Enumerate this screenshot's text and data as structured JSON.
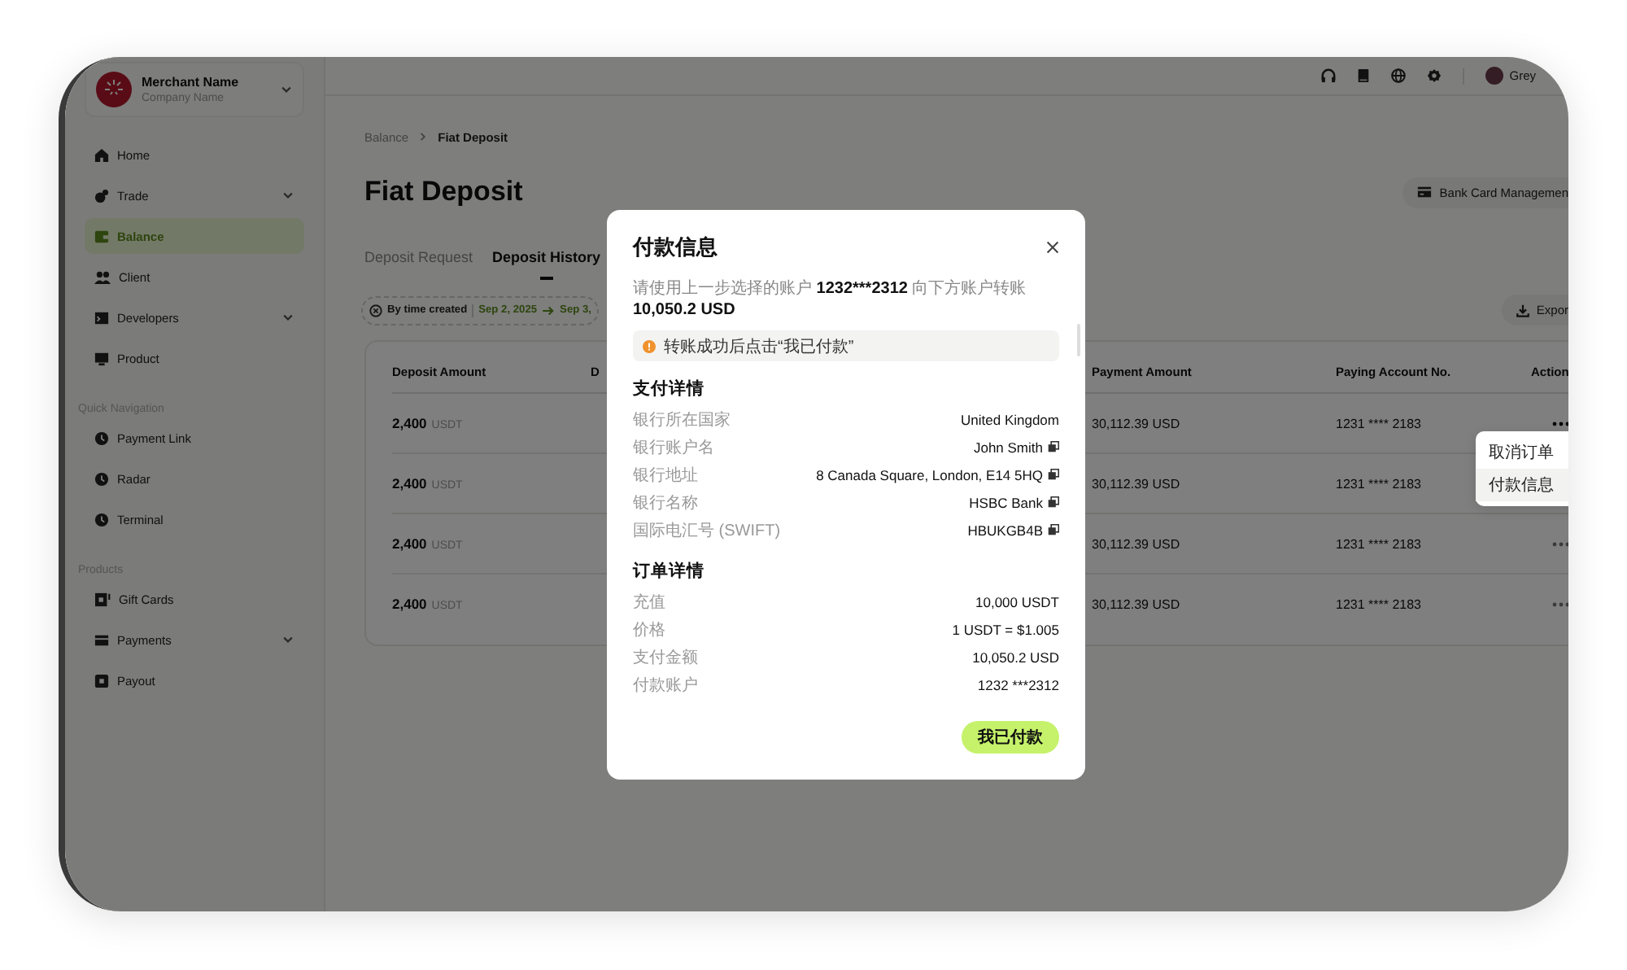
{
  "topbar": {
    "user_name": "Grey"
  },
  "sidebar": {
    "merchant": {
      "name": "Merchant Name",
      "company": "Company Name"
    },
    "items": [
      {
        "kind": "item",
        "label": "Home",
        "expandable": false,
        "selected": false
      },
      {
        "kind": "item",
        "label": "Trade",
        "expandable": true,
        "selected": false
      },
      {
        "kind": "item",
        "label": "Balance",
        "expandable": false,
        "selected": true
      },
      {
        "kind": "item",
        "label": "Client",
        "expandable": false,
        "selected": false
      },
      {
        "kind": "item",
        "label": "Developers",
        "expandable": true,
        "selected": false
      },
      {
        "kind": "item",
        "label": "Product",
        "expandable": false,
        "selected": false
      },
      {
        "kind": "heading",
        "label": "Quick Navigation"
      },
      {
        "kind": "item",
        "label": "Payment Link",
        "expandable": false,
        "selected": false
      },
      {
        "kind": "item",
        "label": "Radar",
        "expandable": false,
        "selected": false
      },
      {
        "kind": "item",
        "label": "Terminal",
        "expandable": false,
        "selected": false
      },
      {
        "kind": "heading",
        "label": "Products"
      },
      {
        "kind": "item",
        "label": "Gift Cards",
        "expandable": false,
        "selected": false
      },
      {
        "kind": "item",
        "label": "Payments",
        "expandable": true,
        "selected": false
      },
      {
        "kind": "item",
        "label": "Payout",
        "expandable": false,
        "selected": false
      }
    ]
  },
  "breadcrumb": [
    {
      "label": "Balance",
      "current": false
    },
    {
      "label": "Fiat Deposit",
      "current": true
    }
  ],
  "page_title": "Fiat Deposit",
  "header_button": "Bank Card Managemen",
  "tabs": [
    {
      "label": "Deposit Request",
      "selected": false
    },
    {
      "label": "Deposit History",
      "selected": true
    }
  ],
  "filter": {
    "label": "By time created",
    "start": "Sep 2, 2025",
    "end": "Sep 3,"
  },
  "export_button": "Expor",
  "table": {
    "columns": [
      "Deposit Amount",
      "D",
      "Payment Amount",
      "Paying Account No.",
      "Action"
    ],
    "rows": [
      {
        "amount": "2,400",
        "unit": "USDT",
        "payment": "30,112.39 USD",
        "account": "1231 **** 2183",
        "menu_open": true
      },
      {
        "amount": "2,400",
        "unit": "USDT",
        "payment": "30,112.39 USD",
        "account": "1231 **** 2183",
        "menu_open": false
      },
      {
        "amount": "2,400",
        "unit": "USDT",
        "payment": "30,112.39 USD",
        "account": "1231 **** 2183",
        "menu_open": false
      },
      {
        "amount": "2,400",
        "unit": "USDT",
        "payment": "30,112.39 USD",
        "account": "1231 **** 2183",
        "menu_open": false
      }
    ],
    "row_menu": [
      {
        "label": "取消订单",
        "selected": false
      },
      {
        "label": "付款信息",
        "selected": true
      }
    ]
  },
  "modal": {
    "title": "付款信息",
    "description": [
      {
        "text": "请使用上一步选择的账户",
        "bold": false
      },
      {
        "text": "1232***2312",
        "bold": true
      },
      {
        "text": "向下方账户转账",
        "bold": false
      },
      {
        "text": "10,050.2 USD",
        "bold": true
      }
    ],
    "notice": "转账成功后点击“我已付款”",
    "sections": [
      {
        "title": "支付详情",
        "rows": [
          {
            "label": "银行所在国家",
            "value": "United Kingdom",
            "copyable": false
          },
          {
            "label": "银行账户名",
            "value": "John Smith",
            "copyable": true
          },
          {
            "label": "银行地址",
            "value": "8 Canada Square, London, E14 5HQ",
            "copyable": true
          },
          {
            "label": "银行名称",
            "value": "HSBC Bank",
            "copyable": true
          },
          {
            "label": "国际电汇号 (SWIFT)",
            "value": "HBUKGB4B",
            "copyable": true
          }
        ]
      },
      {
        "title": "订单详情",
        "rows": [
          {
            "label": "充值",
            "value": "10,000 USDT",
            "copyable": false
          },
          {
            "label": "价格",
            "value": "1 USDT = $1.005",
            "copyable": false
          },
          {
            "label": "支付金额",
            "value": "10,050.2 USD",
            "copyable": false
          },
          {
            "label": "付款账户",
            "value": "1232 ***2312",
            "copyable": false
          }
        ]
      }
    ],
    "confirm_button": "我已付款"
  }
}
